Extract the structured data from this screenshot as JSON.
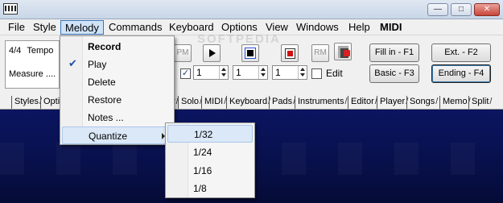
{
  "menubar": {
    "items": [
      "File",
      "Style",
      "Melody",
      "Commands",
      "Keyboard",
      "Options",
      "View",
      "Windows",
      "Help",
      "MIDI"
    ]
  },
  "window_buttons": {
    "minimize": "—",
    "restore": "□",
    "close": "✕"
  },
  "info": {
    "time_signature": "4/4",
    "tempo_label": "Tempo",
    "measure_label": "Measure ...."
  },
  "toolbar": {
    "pm_label": "PM",
    "rm_label": "RM",
    "loop_fragment": "p",
    "spin_values": [
      "1",
      "1",
      "1"
    ],
    "edit_label": "Edit"
  },
  "buttons": {
    "fill_in": "Fill in - F1",
    "ext": "Ext. - F2",
    "basic": "Basic - F3",
    "ending": "Ending - F4"
  },
  "tabs": [
    "Styles",
    "Opti",
    "r",
    "Solo",
    "MIDI",
    "Keyboard",
    "Pads",
    "Instruments",
    "Editor",
    "Player",
    "Songs",
    "Memo",
    "Split"
  ],
  "melody_menu": {
    "items": [
      "Record",
      "Play",
      "Delete",
      "Restore",
      "Notes ...",
      "Quantize"
    ]
  },
  "quantize_menu": {
    "items": [
      "1/32",
      "1/24",
      "1/16",
      "1/8"
    ]
  },
  "watermark": "SOFTPEDIA"
}
